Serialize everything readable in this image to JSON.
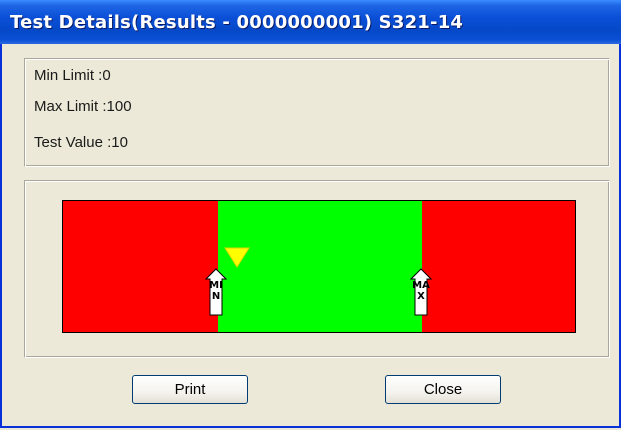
{
  "window": {
    "title": "Test Details(Results - 0000000001) S321-14"
  },
  "details": {
    "min_limit": "Min Limit :0",
    "max_limit": "Max Limit :100",
    "test_value": "Test Value :10"
  },
  "gauge": {
    "min_label": "MIN",
    "max_label": "MAX",
    "colors": {
      "out_of_range": "#ff0000",
      "in_range": "#00ff00",
      "value_pointer": "#ffff00"
    }
  },
  "buttons": {
    "print_label": "Print",
    "close_label": "Close"
  }
}
